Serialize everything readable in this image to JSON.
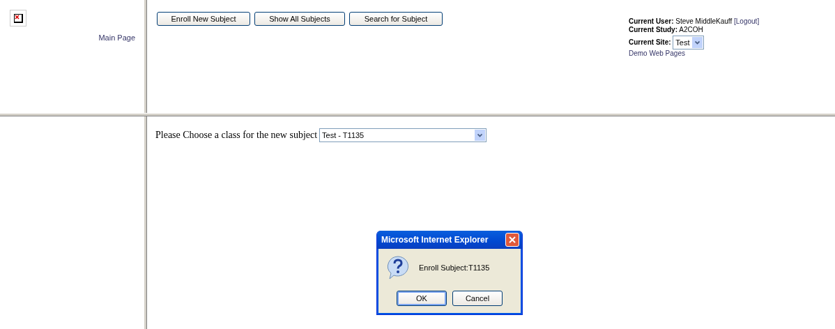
{
  "nav": {
    "link": "Main Page"
  },
  "toolbar": {
    "buttons": [
      "Enroll New Subject",
      "Show All Subjects",
      "Search for Subject"
    ]
  },
  "user_info": {
    "user_label": "Current User:",
    "user": "Steve MiddleKauff",
    "logout": "[Logout]",
    "study_label": "Current Study:",
    "study": "A2COH",
    "site_label": "Current Site:",
    "site": "Test",
    "demo_link": "Demo Web Pages"
  },
  "content": {
    "prompt": "Please Choose a class for the new subject",
    "class_value": "Test - T1135"
  },
  "dialog": {
    "title": "Microsoft Internet Explorer",
    "message": "Enroll Subject:T1135",
    "buttons": [
      {
        "label": "OK",
        "selected": true
      },
      {
        "label": "Cancel",
        "selected": false
      }
    ]
  }
}
